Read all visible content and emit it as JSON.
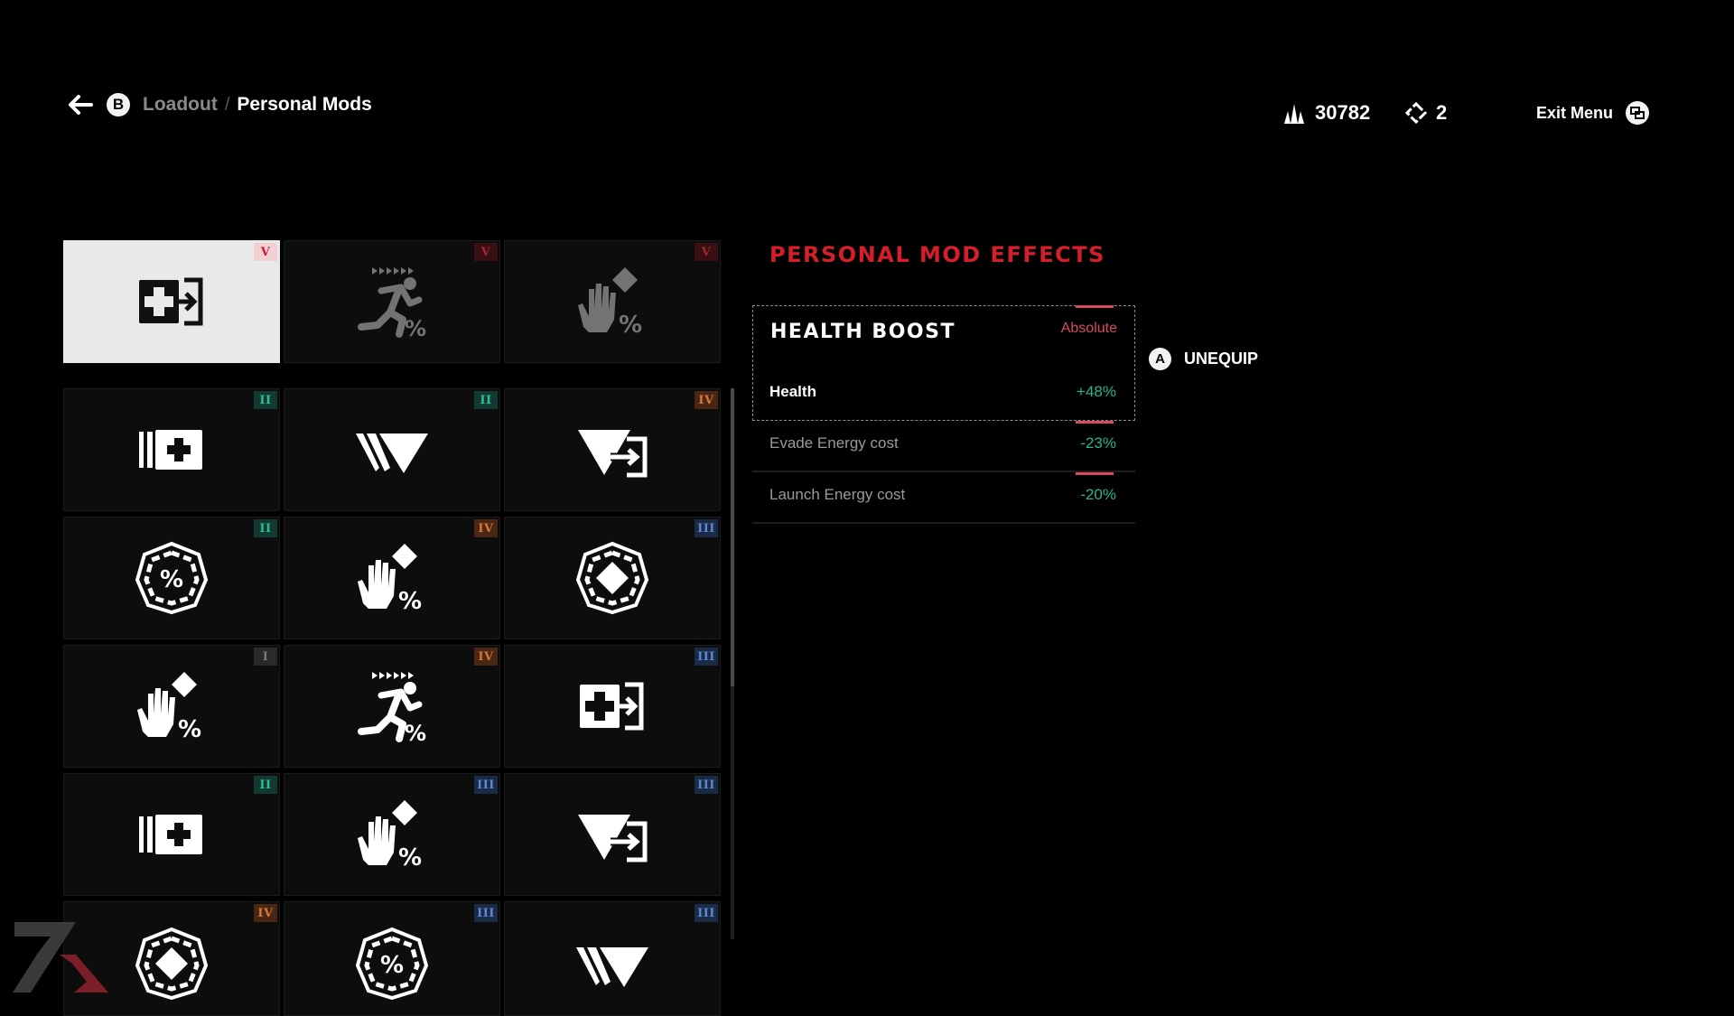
{
  "header": {
    "back_button": "B",
    "breadcrumb_parent": "Loadout",
    "breadcrumb_separator": "/",
    "breadcrumb_current": "Personal Mods",
    "currency1_value": "30782",
    "currency2_value": "2",
    "exit_label": "Exit Menu"
  },
  "equipped_slots": [
    {
      "icon": "health-boost-icon",
      "tier": "V",
      "state": "selected"
    },
    {
      "icon": "sprint-percent-icon",
      "tier": "V",
      "state": "dimmed"
    },
    {
      "icon": "grab-diamond-percent-icon",
      "tier": "V",
      "state": "dimmed"
    }
  ],
  "inventory": [
    {
      "icon": "health-bars-icon",
      "tier": "II"
    },
    {
      "icon": "evade-triangle-icon",
      "tier": "II"
    },
    {
      "icon": "triangle-launch-icon",
      "tier": "IV"
    },
    {
      "icon": "percent-gear-icon",
      "tier": "II"
    },
    {
      "icon": "grab-diamond-percent-icon",
      "tier": "IV"
    },
    {
      "icon": "diamond-gear-icon",
      "tier": "III"
    },
    {
      "icon": "grab-diamond-percent-icon",
      "tier": "I"
    },
    {
      "icon": "sprint-percent-icon",
      "tier": "IV"
    },
    {
      "icon": "health-boost-icon",
      "tier": "III"
    },
    {
      "icon": "health-bars-icon",
      "tier": "II"
    },
    {
      "icon": "grab-diamond-percent-icon",
      "tier": "III"
    },
    {
      "icon": "triangle-launch-icon",
      "tier": "III"
    },
    {
      "icon": "diamond-gear-icon",
      "tier": "IV"
    },
    {
      "icon": "percent-gear-icon",
      "tier": "III"
    },
    {
      "icon": "evade-triangle-icon",
      "tier": "III"
    }
  ],
  "effects_panel": {
    "title": "PERSONAL MOD EFFECTS",
    "mod_name": "HEALTH BOOST",
    "mod_type": "Absolute",
    "stats": [
      {
        "label": "Health",
        "value": "+48%"
      },
      {
        "label": "Evade Energy cost",
        "value": "-23%"
      },
      {
        "label": "Launch Energy cost",
        "value": "-20%"
      }
    ],
    "unequip_button": "A",
    "unequip_label": "UNEQUIP"
  },
  "colors": {
    "accent_red": "#d41e2c",
    "positive_green": "#27b58b",
    "tier_I": "#7a7a7a",
    "tier_II": "#2fbf93",
    "tier_III": "#5b87d3",
    "tier_IV": "#d77636",
    "tier_V": "#a4262f"
  }
}
